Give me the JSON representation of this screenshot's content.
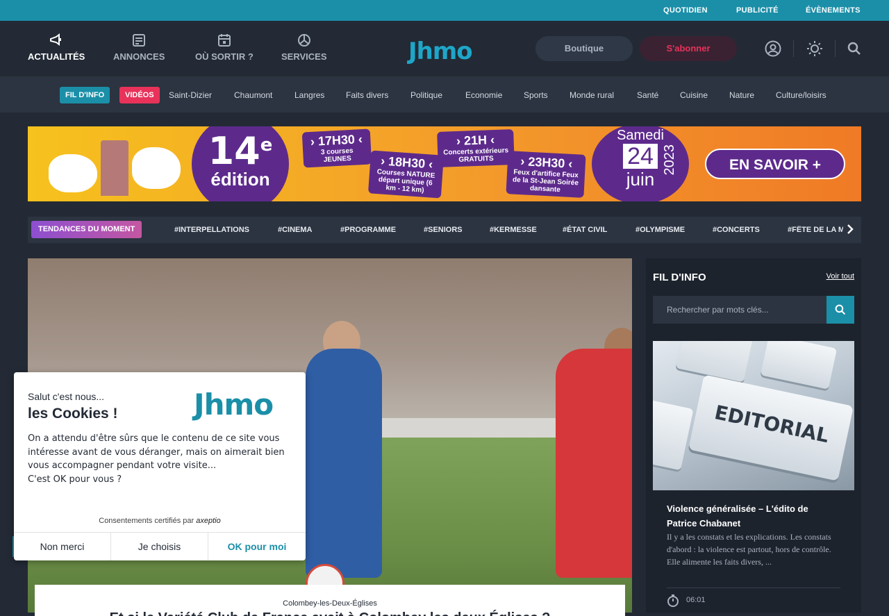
{
  "topbar": {
    "links": [
      "QUOTIDIEN",
      "PUBLICITÉ",
      "ÉVÈNEMENTS"
    ]
  },
  "header": {
    "nav": [
      {
        "label": "ACTUALITÉS",
        "icon": "megaphone-icon",
        "active": true
      },
      {
        "label": "ANNONCES",
        "icon": "listing-icon",
        "active": false
      },
      {
        "label": "OÙ SORTIR ?",
        "icon": "calendar-icon",
        "active": false
      },
      {
        "label": "SERVICES",
        "icon": "services-icon",
        "active": false
      }
    ],
    "logo": "Jhmo",
    "boutique": "Boutique",
    "subscribe": "S'abonner"
  },
  "categories": {
    "fil": "FIL D'INFO",
    "videos": "VIDÉOS",
    "items": [
      "Saint-Dizier",
      "Chaumont",
      "Langres",
      "Faits divers",
      "Politique",
      "Economie",
      "Sports",
      "Monde rural",
      "Santé",
      "Cuisine",
      "Nature",
      "Culture/loisirs"
    ]
  },
  "banner": {
    "edition_number": "14",
    "edition_suffix": "e",
    "edition_word": "édition",
    "box1_time": "› 17H30 ‹",
    "box1_text": "3 courses JEUNES",
    "box2_time": "› 18H30 ‹",
    "box2_text": "Courses NATURE départ unique (6 km - 12 km)",
    "box3_time": "› 21H ‹",
    "box3_text": "Concerts extérieurs GRATUITS",
    "box4_time": "› 23H30 ‹",
    "box4_text": "Feux d'artifice Feux de la St-Jean Soirée dansante",
    "date_day": "Samedi",
    "date_num": "24",
    "date_month": "juin",
    "date_year": "2023",
    "cta": "EN SAVOIR +"
  },
  "trends": {
    "label": "TENDANCES DU MOMENT",
    "tags": [
      "#INTERPELLATIONS",
      "#CINEMA",
      "#PROGRAMME",
      "#SENIORS",
      "#KERMESSE",
      "#ÉTAT CIVIL",
      "#OLYMPISME",
      "#CONCERTS",
      "#FÊTE DE LA M"
    ]
  },
  "hero": {
    "location": "Colombey-les-Deux-Églises",
    "title": "Et si le Variété Club de France avait à Colombey les deux Églises ?"
  },
  "sidebar": {
    "title": "FIL D'INFO",
    "see_all": "Voir tout",
    "search_placeholder": "Rechercher par mots clés...",
    "article": {
      "image_text": "EDITORIAL",
      "title": "Violence généralisée – L'édito de Patrice Chabanet",
      "excerpt": "Il y a les constats et les explications. Les constats d'abord : la violence est partout, hors de contrôle. Elle alimente les faits divers, ...",
      "time": "06:01"
    }
  },
  "cookie": {
    "hello": "Salut c'est nous...",
    "title": "les Cookies !",
    "logo": "Jhmo",
    "body_1": "On a attendu d'être sûrs que le contenu de ce site vous intéresse avant de vous déranger, mais on aimerait bien vous accompagner pendant votre visite...",
    "body_2": "C'est OK pour vous ?",
    "certified": "Consentements certifiés par",
    "certified_brand": "axeptio",
    "btn_no": "Non merci",
    "btn_choose": "Je choisis",
    "btn_ok": "OK pour moi"
  }
}
